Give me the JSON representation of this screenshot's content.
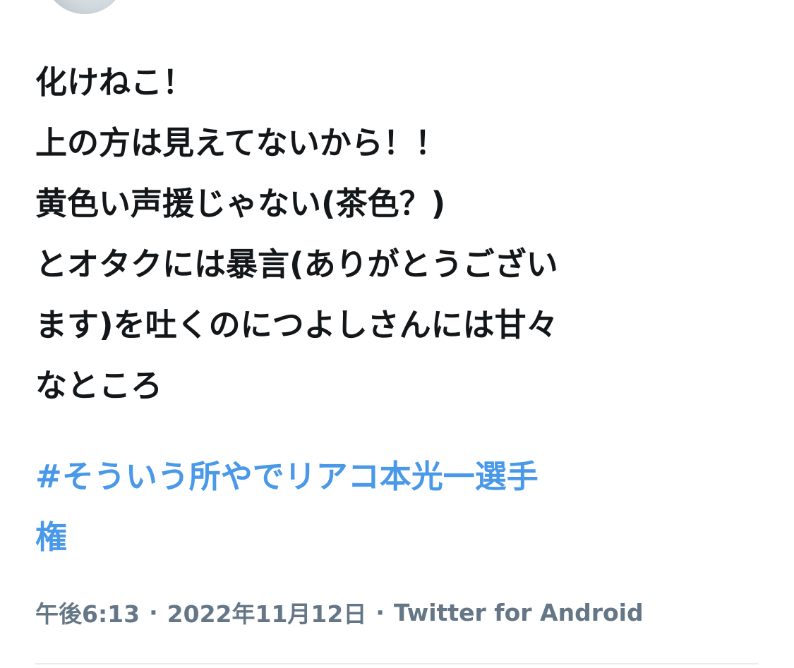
{
  "tweet": {
    "text": "化けねこ！\n上の方は見えてないから！！\n黄色い声援じゃない(茶色？)\nとオタクには暴言(ありがとうござい\nます)を吐くのにつよしさんには甘々\nなところ",
    "hashtag": "#そういう所やでリアコ本光一選手\n権",
    "time": "午後6:13",
    "separator": "·",
    "date": "2022年11月12日",
    "source": "Twitter for Android"
  },
  "colors": {
    "text": "#14171a",
    "link": "#4a99e9",
    "meta": "#657786",
    "divider": "#e6ecf0"
  }
}
